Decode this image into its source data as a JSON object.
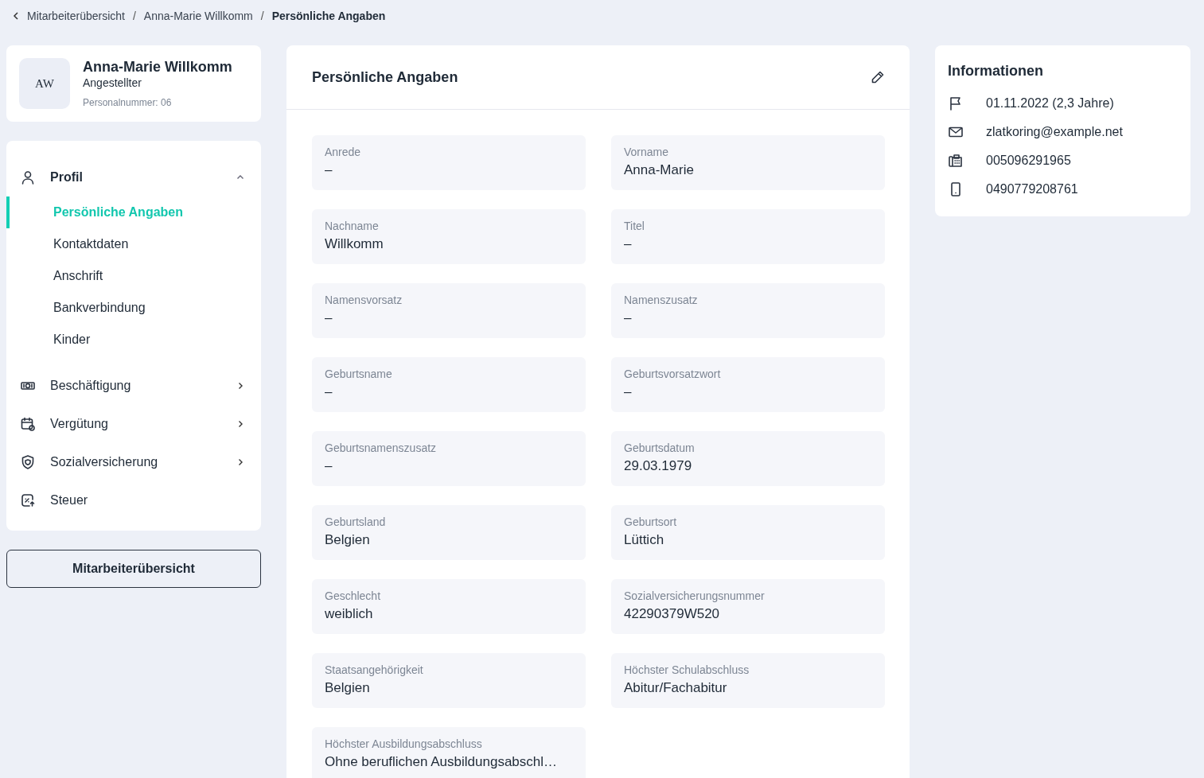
{
  "breadcrumb": [
    {
      "label": "Mitarbeiterübersicht",
      "current": false
    },
    {
      "separator": "/",
      "label": "Anna-Marie Willkomm",
      "current": false
    },
    {
      "separator": "/",
      "label": "Persönliche Angaben",
      "current": true
    }
  ],
  "employee": {
    "initials": "AW",
    "name": "Anna-Marie Willkomm",
    "role": "Angestellter",
    "number_label": "Personalnummer:",
    "number": "06"
  },
  "nav": [
    {
      "label": "Profil",
      "expanded": true,
      "children": [
        {
          "label": "Persönliche Angaben",
          "selected": true
        },
        {
          "label": "Kontaktdaten",
          "selected": false
        },
        {
          "label": "Anschrift",
          "selected": false
        },
        {
          "label": "Bankverbindung",
          "selected": false
        },
        {
          "label": "Kinder",
          "selected": false
        }
      ]
    },
    {
      "label": "Beschäftigung",
      "expanded": false
    },
    {
      "label": "Vergütung",
      "expanded": false
    },
    {
      "label": "Sozialversicherung",
      "expanded": false
    },
    {
      "label": "Steuer"
    }
  ],
  "overview_button": "Mitarbeiterübersicht",
  "panel": {
    "title": "Persönliche Angaben",
    "fields": [
      {
        "label": "Anrede",
        "value": "–"
      },
      {
        "label": "Vorname",
        "value": "Anna-Marie"
      },
      {
        "label": "Nachname",
        "value": "Willkomm"
      },
      {
        "label": "Titel",
        "value": "–"
      },
      {
        "label": "Namensvorsatz",
        "value": "–"
      },
      {
        "label": "Namenszusatz",
        "value": "–"
      },
      {
        "label": "Geburtsname",
        "value": "–"
      },
      {
        "label": "Geburtsvorsatzwort",
        "value": "–"
      },
      {
        "label": "Geburtsnamenszusatz",
        "value": "–"
      },
      {
        "label": "Geburtsdatum",
        "value": "29.03.1979"
      },
      {
        "label": "Geburtsland",
        "value": "Belgien"
      },
      {
        "label": "Geburtsort",
        "value": "Lüttich"
      },
      {
        "label": "Geschlecht",
        "value": "weiblich"
      },
      {
        "label": "Sozialversicherungsnummer",
        "value": "42290379W520"
      },
      {
        "label": "Staatsangehörigkeit",
        "value": "Belgien"
      },
      {
        "label": "Höchster Schulabschluss",
        "value": "Abitur/Fachabitur"
      },
      {
        "label": "Höchster Ausbildungsabschluss",
        "value": "Ohne beruflichen Ausbildungsabschl…"
      }
    ]
  },
  "info": {
    "title": "Informationen",
    "items": [
      {
        "text": "01.11.2022 (2,3 Jahre)"
      },
      {
        "text": "zlatkoring@example.net"
      },
      {
        "text": "005096291965"
      },
      {
        "text": "0490779208761"
      }
    ]
  }
}
